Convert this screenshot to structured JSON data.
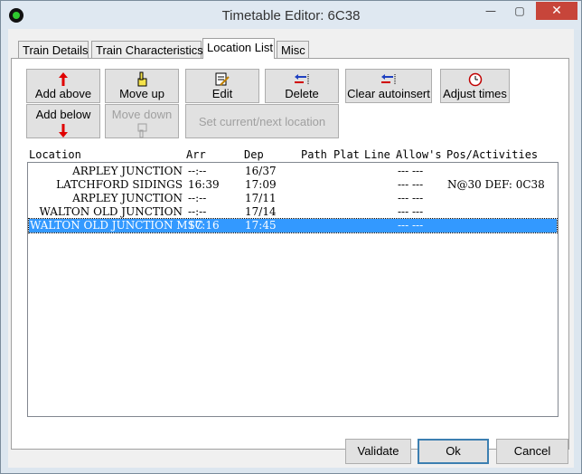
{
  "window": {
    "title": "Timetable Editor: 6C38",
    "minimize": "—",
    "maximize": "▢",
    "close": "✕"
  },
  "tabs": [
    {
      "label": "Train Details"
    },
    {
      "label": "Train Characteristics"
    },
    {
      "label": "Location List"
    },
    {
      "label": "Misc"
    }
  ],
  "toolbar": {
    "add_above": "Add above",
    "add_below": "Add below",
    "move_up": "Move up",
    "move_down": "Move down",
    "edit": "Edit",
    "delete": "Delete",
    "set_current": "Set current/next location",
    "clear_autoinsert": "Clear autoinsert",
    "adjust_times": "Adjust times"
  },
  "list": {
    "headers": [
      "Location",
      "Arr",
      "Dep",
      "Path",
      "Plat",
      "Line",
      "Allow's",
      "Pos/Activities"
    ],
    "rows": [
      {
        "location": "ARPLEY JUNCTION",
        "arr": "--:--",
        "dep": "16/37",
        "allow": "--- ---",
        "pos": ""
      },
      {
        "location": "LATCHFORD SIDINGS",
        "arr": "16:39",
        "dep": "17:09",
        "allow": "--- ---",
        "pos": "N@30 DEF: 0C38"
      },
      {
        "location": "ARPLEY JUNCTION",
        "arr": "--:--",
        "dep": "17/11",
        "allow": "--- ---",
        "pos": ""
      },
      {
        "location": "WALTON OLD JUNCTION",
        "arr": "--:--",
        "dep": "17/14",
        "allow": "--- ---",
        "pos": ""
      },
      {
        "location": "WALTON OLD JUNCTION MSC",
        "arr": "17:16",
        "dep": "17:45",
        "allow": "--- ---",
        "pos": ""
      }
    ]
  },
  "footer": {
    "validate": "Validate",
    "ok": "Ok",
    "cancel": "Cancel"
  }
}
